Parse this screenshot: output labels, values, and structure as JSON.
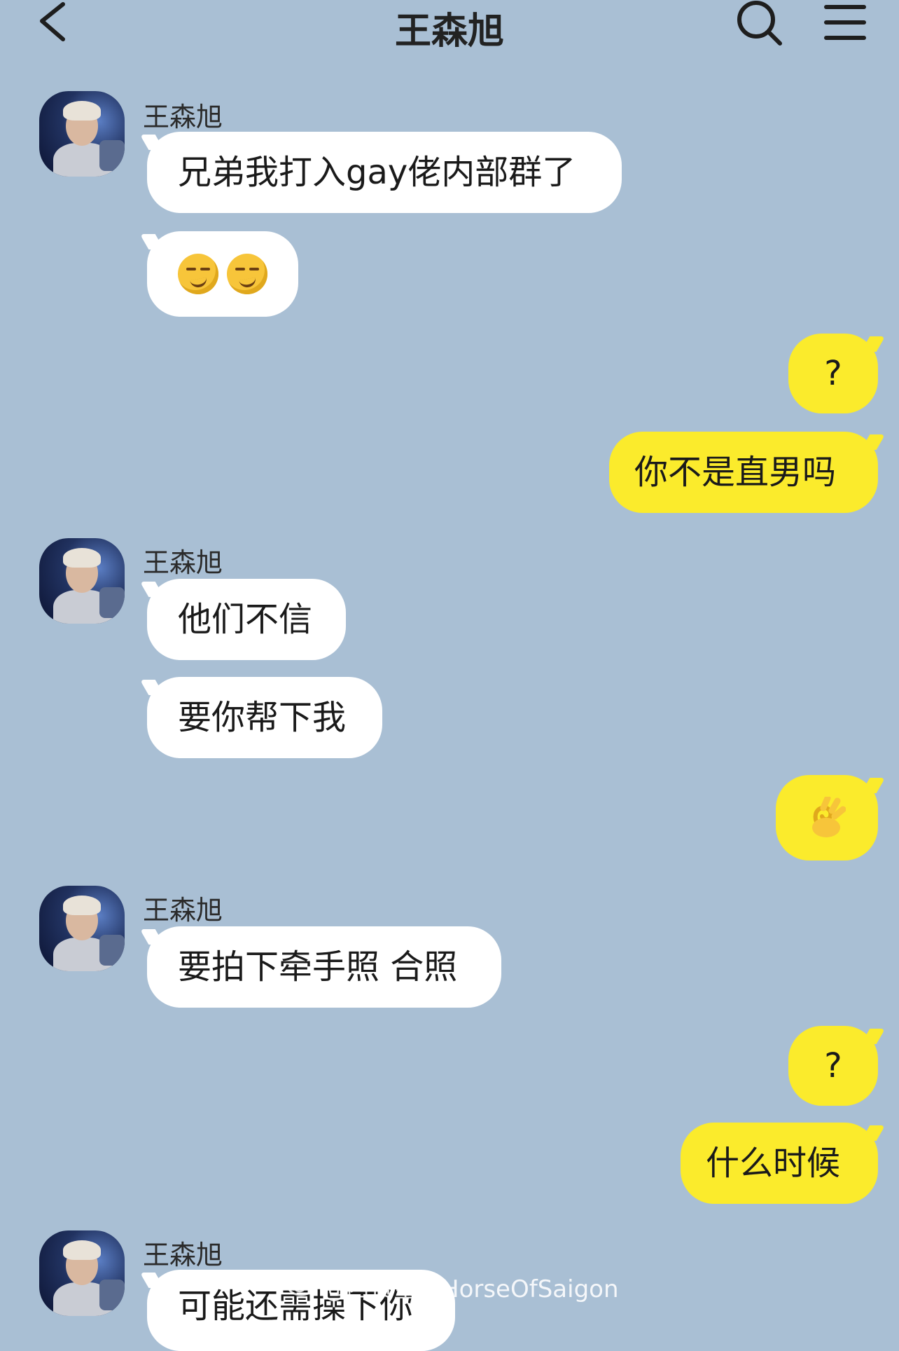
{
  "header": {
    "title": "王森旭",
    "back_icon": "chevron-left-icon",
    "search_icon": "search-icon",
    "menu_icon": "menu-icon"
  },
  "contact": {
    "name": "王森旭"
  },
  "messages": [
    {
      "side": "in",
      "show_name": true,
      "text": "兄弟我打入gay佬内部群了"
    },
    {
      "side": "in",
      "show_name": false,
      "emoji": [
        "smirking-face-emoji",
        "smirking-face-emoji"
      ]
    },
    {
      "side": "out",
      "text": "?"
    },
    {
      "side": "out",
      "text": "你不是直男吗"
    },
    {
      "side": "in",
      "show_name": true,
      "text": "他们不信"
    },
    {
      "side": "in",
      "show_name": false,
      "text": "要你帮下我"
    },
    {
      "side": "out",
      "emoji": [
        "ok-hand-emoji"
      ]
    },
    {
      "side": "in",
      "show_name": true,
      "text": "要拍下牵手照 合照"
    },
    {
      "side": "out",
      "text": "?"
    },
    {
      "side": "out",
      "text": "什么时候"
    },
    {
      "side": "in",
      "show_name": true,
      "text": "可能还需操下你"
    }
  ],
  "watermark": "@西贡皇后HorseOfSaigon",
  "colors": {
    "background": "#a9bfd4",
    "outgoing_bubble": "#fbeb2c",
    "incoming_bubble": "#ffffff"
  }
}
